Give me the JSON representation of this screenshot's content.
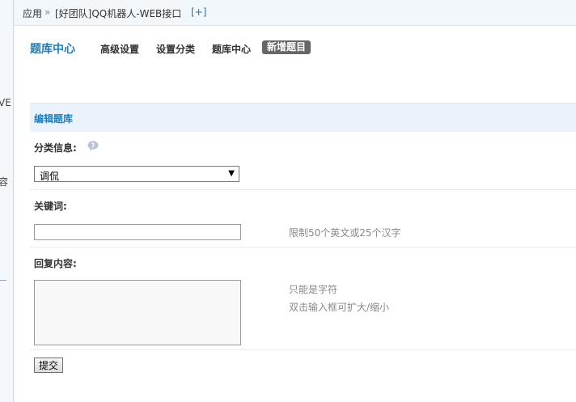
{
  "breadcrumb": {
    "app": "应用",
    "separator": "»",
    "plugin": "[好团队]QQ机器人-WEB接口",
    "add": "[+]"
  },
  "left_strip": {
    "fragment_1": "VE",
    "fragment_2": "容"
  },
  "nav": {
    "title": "题库中心",
    "items": [
      {
        "label": "高级设置"
      },
      {
        "label": "设置分类"
      },
      {
        "label": "题库中心"
      }
    ],
    "active": "新增题目"
  },
  "section": {
    "title": "编辑题库"
  },
  "form": {
    "category_label": "分类信息:",
    "category_value": "调侃",
    "keyword_label": "关键词:",
    "keyword_value": "",
    "keyword_hint": "限制50个英文或25个汉字",
    "reply_label": "回复内容:",
    "reply_value": "",
    "reply_hint_1": "只能是字符",
    "reply_hint_2": "双击输入框可扩大/缩小",
    "submit_label": "提交"
  },
  "icons": {
    "help": "help-bubble-icon",
    "dropdown": "chevron-down-icon"
  },
  "colors": {
    "accent": "#1b7fc1",
    "active_tab_bg": "#666666",
    "section_bg": "#eaf3fb"
  }
}
